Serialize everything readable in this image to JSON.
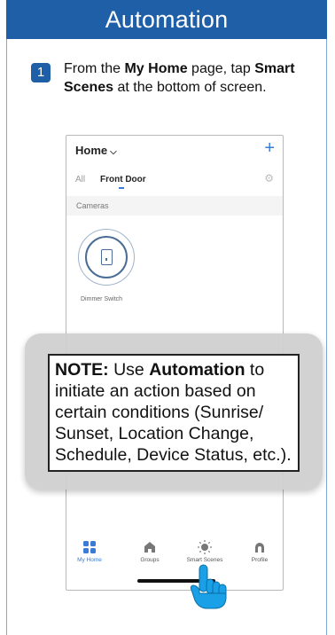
{
  "header": {
    "title": "Automation"
  },
  "step": {
    "number": "1",
    "pre1": "From the ",
    "bold1": "My Home",
    "mid": " page, tap ",
    "bold2": "Smart Scenes",
    "post": " at the bottom of screen."
  },
  "phone": {
    "title": "Home",
    "tabs": [
      "All",
      "Front Door"
    ],
    "section": "Cameras",
    "device_label": "Dimmer Switch",
    "nav": [
      "My Home",
      "Groups",
      "Smart Scenes",
      "Profile"
    ]
  },
  "note": {
    "prefix": "NOTE:",
    "pre": " Use ",
    "bold": "Automation",
    "post": " to initiate an action based on certain conditions (Sunrise/ Sunset, Location Change, Schedule, Device Status, etc.)."
  },
  "colors": {
    "brand": "#1f5fa8",
    "accent": "#3a7bd5",
    "tap_hand": "#1aa0e6"
  }
}
